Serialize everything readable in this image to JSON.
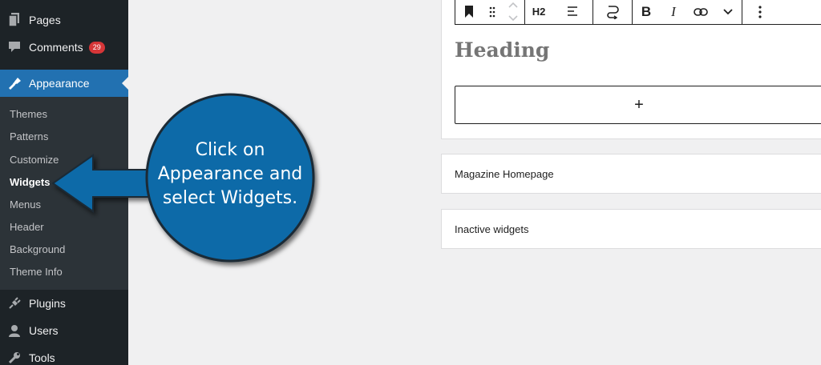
{
  "sidebar": {
    "items": [
      {
        "label": "Pages",
        "icon": "pages-icon"
      },
      {
        "label": "Comments",
        "icon": "comments-icon",
        "badge": "29"
      },
      {
        "label": "Appearance",
        "icon": "appearance-icon"
      },
      {
        "label": "Plugins",
        "icon": "plugins-icon"
      },
      {
        "label": "Users",
        "icon": "users-icon"
      },
      {
        "label": "Tools",
        "icon": "tools-icon"
      }
    ],
    "submenu": [
      "Themes",
      "Patterns",
      "Customize",
      "Widgets",
      "Menus",
      "Header",
      "Background",
      "Theme Info"
    ]
  },
  "toolbar": {
    "heading_level": "H2",
    "icons": [
      "bookmark-icon",
      "drag-icon",
      "move-arrows-icon",
      "align-icon",
      "link-transform-icon",
      "bold-icon",
      "italic-icon",
      "link-icon",
      "chevron-down-icon",
      "more-options-icon"
    ]
  },
  "editor": {
    "heading": "Heading",
    "appender_symbol": "+"
  },
  "widget_areas": [
    "Magazine Homepage",
    "Inactive widgets"
  ],
  "callout": {
    "lines": [
      "Click on",
      "Appearance and",
      "select Widgets."
    ],
    "color": "#0a6aa8"
  },
  "colors": {
    "sidebar_bg": "#1d2327",
    "submenu_bg": "#2c3338",
    "active_bg": "#2271b1",
    "badge": "#d63638"
  }
}
